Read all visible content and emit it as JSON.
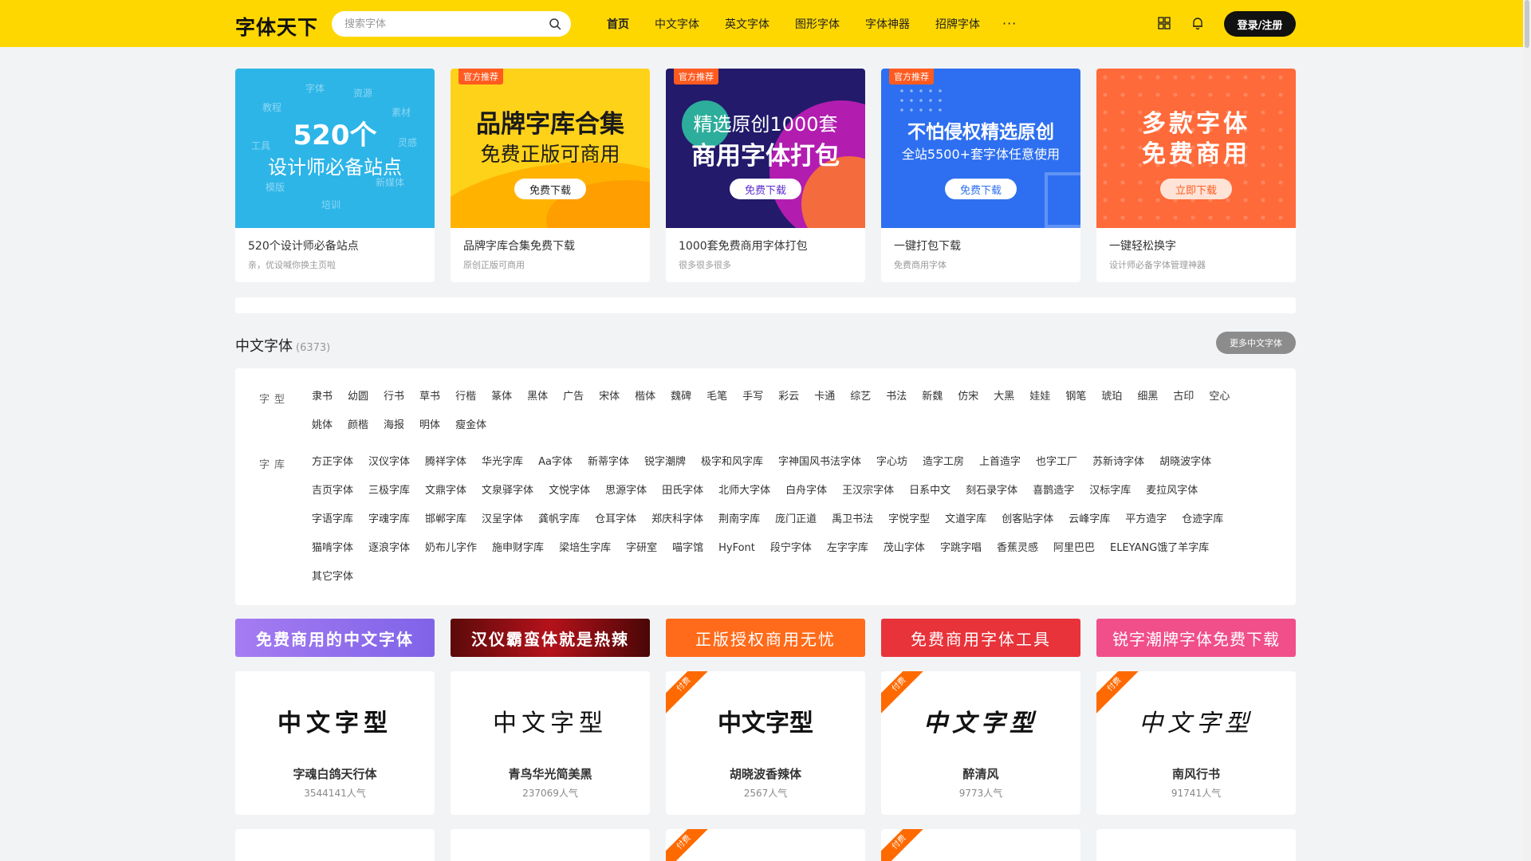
{
  "header": {
    "logo": "字体天下",
    "search_placeholder": "搜索字体",
    "nav": [
      "首页",
      "中文字体",
      "英文字体",
      "图形字体",
      "字体神器",
      "招牌字体"
    ],
    "more": "···",
    "login": "登录/注册"
  },
  "banners": [
    {
      "line1": "520个",
      "line2": "设计师必备站点",
      "button": "",
      "title": "520个设计师必备站点",
      "subtitle": "亲，优设喊你换主页啦",
      "tag": "",
      "words": [
        "字体",
        "资源",
        "教程",
        "素材",
        "工具",
        "灵感",
        "模版",
        "新媒体",
        "培训"
      ]
    },
    {
      "line1": "品牌字库合集",
      "line2": "免费正版可商用",
      "button": "免费下载",
      "title": "品牌字库合集免费下载",
      "subtitle": "原创正版可商用",
      "tag": "官方推荐"
    },
    {
      "line1": "精选原创1000套",
      "line2": "商用字体打包",
      "button": "免费下载",
      "title": "1000套免费商用字体打包",
      "subtitle": "很多很多很多",
      "tag": "官方推荐"
    },
    {
      "line1": "不怕侵权精选原创",
      "line2": "全站5500+套字体任意使用",
      "button": "免费下载",
      "title": "一键打包下载",
      "subtitle": "免费商用字体",
      "tag": "官方推荐"
    },
    {
      "line1": "多款字体",
      "line2": "免费商用",
      "button": "立即下载",
      "title": "一键轻松换字",
      "subtitle": "设计师必备字体管理神器",
      "tag": ""
    }
  ],
  "section": {
    "title": "中文字体",
    "count": "(6373)",
    "more": "更多中文字体"
  },
  "filters": {
    "type_label": "字型",
    "types": [
      "隶书",
      "幼圆",
      "行书",
      "草书",
      "行楷",
      "篆体",
      "黑体",
      "广告",
      "宋体",
      "楷体",
      "魏碑",
      "毛笔",
      "手写",
      "彩云",
      "卡通",
      "综艺",
      "书法",
      "新魏",
      "仿宋",
      "大黑",
      "娃娃",
      "钢笔",
      "琥珀",
      "细黑",
      "古印",
      "空心",
      "姚体",
      "颜楷",
      "海报",
      "明体",
      "瘦金体"
    ],
    "lib_label": "字库",
    "libs": [
      "方正字体",
      "汉仪字体",
      "腾祥字体",
      "华光字库",
      "Aa字体",
      "新蒂字体",
      "锐字潮牌",
      "极字和风字库",
      "字神国风书法字体",
      "字心坊",
      "造字工房",
      "上首造字",
      "也字工厂",
      "苏新诗字体",
      "胡晓波字体",
      "吉页字体",
      "三极字库",
      "文鼎字体",
      "文泉驿字体",
      "文悦字体",
      "思源字体",
      "田氏字体",
      "北师大字体",
      "白舟字体",
      "王汉宗字体",
      "日系中文",
      "刻石录字体",
      "喜鹊造字",
      "汉标字库",
      "麦拉风字体",
      "字语字库",
      "字魂字库",
      "邯郸字库",
      "汉呈字体",
      "龚帆字库",
      "仓耳字体",
      "郑庆科字体",
      "荆南字库",
      "庞门正道",
      "禹卫书法",
      "字悦字型",
      "文道字库",
      "创客贴字体",
      "云峰字库",
      "平方造字",
      "仓迹字库",
      "猫啃字体",
      "逐浪字体",
      "奶布儿字作",
      "施申财字库",
      "梁培生字库",
      "字研室",
      "喵字馆",
      "HyFont",
      "段宁字体",
      "左字字库",
      "茂山字体",
      "字跳字唱",
      "香蕉灵感",
      "阿里巴巴",
      "ELEYANG饿了羊字库",
      "其它字体"
    ]
  },
  "promos": [
    "免费商用的中文字体",
    "汉仪霸蛮体就是热辣",
    "正版授权商用无忧",
    "免费商用字体工具",
    "锐字潮牌字体免费下载"
  ],
  "font_cards": [
    {
      "preview": "中文字型",
      "name": "字魂白鸽天行体",
      "popularity": "3544141人气",
      "paid": false
    },
    {
      "preview": "中文字型",
      "name": "青鸟华光简美黑",
      "popularity": "237069人气",
      "paid": false
    },
    {
      "preview": "中文字型",
      "name": "胡晓波香辣体",
      "popularity": "2567人气",
      "paid": true
    },
    {
      "preview": "中文字型",
      "name": "醉清风",
      "popularity": "9773人气",
      "paid": true
    },
    {
      "preview": "中文字型",
      "name": "南风行书",
      "popularity": "91741人气",
      "paid": true
    }
  ],
  "paid_label": "付费",
  "colors": {
    "header": "#ffd700",
    "accent_orange": "#ff5a1f"
  }
}
